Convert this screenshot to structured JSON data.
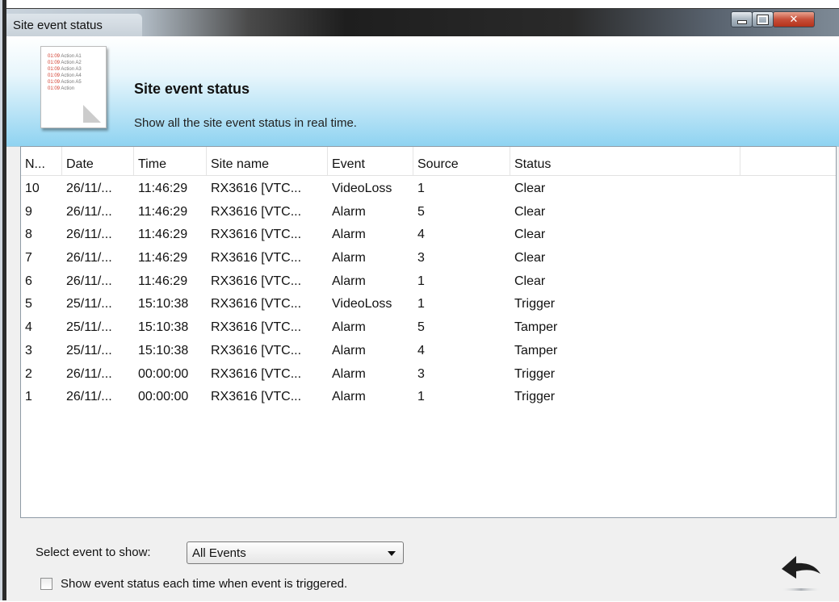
{
  "window": {
    "title": "Site event status"
  },
  "header": {
    "title": "Site event status",
    "subtitle": "Show all the site event status in real time.",
    "icon_lines": [
      {
        "time": "01:09",
        "text": "Action A1"
      },
      {
        "time": "01:09",
        "text": "Action A2"
      },
      {
        "time": "01:09",
        "text": "Action A3"
      },
      {
        "time": "01:09",
        "text": "Action A4"
      },
      {
        "time": "01:09",
        "text": "Action A5"
      },
      {
        "time": "01:09",
        "text": "Action"
      }
    ]
  },
  "table": {
    "columns": [
      "N...",
      "Date",
      "Time",
      "Site name",
      "Event",
      "Source",
      "Status"
    ],
    "rows": [
      [
        "10",
        "26/11/...",
        "11:46:29",
        "RX3616 [VTC...",
        "VideoLoss",
        "1",
        "Clear"
      ],
      [
        "9",
        "26/11/...",
        "11:46:29",
        "RX3616 [VTC...",
        "Alarm",
        "5",
        "Clear"
      ],
      [
        "8",
        "26/11/...",
        "11:46:29",
        "RX3616 [VTC...",
        "Alarm",
        "4",
        "Clear"
      ],
      [
        "7",
        "26/11/...",
        "11:46:29",
        "RX3616 [VTC...",
        "Alarm",
        "3",
        "Clear"
      ],
      [
        "6",
        "26/11/...",
        "11:46:29",
        "RX3616 [VTC...",
        "Alarm",
        "1",
        "Clear"
      ],
      [
        "5",
        "25/11/...",
        "15:10:38",
        "RX3616 [VTC...",
        "VideoLoss",
        "1",
        "Trigger"
      ],
      [
        "4",
        "25/11/...",
        "15:10:38",
        "RX3616 [VTC...",
        "Alarm",
        "5",
        "Tamper"
      ],
      [
        "3",
        "25/11/...",
        "15:10:38",
        "RX3616 [VTC...",
        "Alarm",
        "4",
        "Tamper"
      ],
      [
        "2",
        "26/11/...",
        "00:00:00",
        "RX3616 [VTC...",
        "Alarm",
        "3",
        "Trigger"
      ],
      [
        "1",
        "26/11/...",
        "00:00:00",
        "RX3616 [VTC...",
        "Alarm",
        "1",
        "Trigger"
      ]
    ]
  },
  "filter": {
    "label": "Select event to show:",
    "selected": "All Events"
  },
  "options": {
    "show_each_time_label": "Show event status each time when event is triggered.",
    "show_each_time_checked": false
  },
  "icons": {
    "back": "back-arrow-icon",
    "header": "event-log-document-icon"
  },
  "colors": {
    "header_gradient_bottom": "#8fd3f1",
    "close_button": "#c7503a",
    "icon_time_text": "#d23a2a"
  }
}
